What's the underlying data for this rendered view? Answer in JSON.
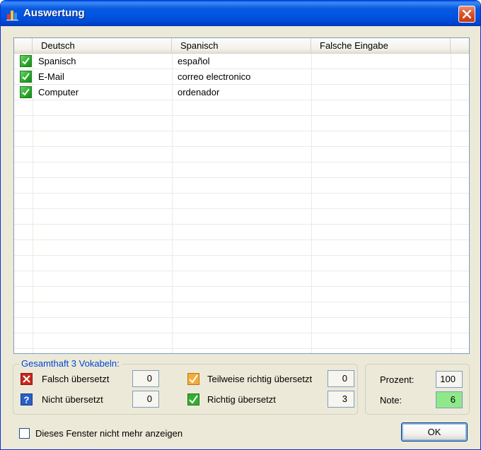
{
  "window": {
    "title": "Auswertung"
  },
  "table": {
    "columns": [
      "Deutsch",
      "Spanisch",
      "Falsche Eingabe"
    ],
    "rows": [
      {
        "status": "check-icon",
        "deutsch": "Spanisch",
        "spanisch": "español",
        "falsch": ""
      },
      {
        "status": "check-icon",
        "deutsch": "E-Mail",
        "spanisch": "correo electronico",
        "falsch": ""
      },
      {
        "status": "check-icon",
        "deutsch": "Computer",
        "spanisch": "ordenador",
        "falsch": ""
      }
    ]
  },
  "summary": {
    "legend": "Gesamthaft 3 Vokabeln:",
    "falsch_label": "Falsch übersetzt",
    "falsch_value": "0",
    "nicht_label": "Nicht übersetzt",
    "nicht_value": "0",
    "teilweise_label": "Teilweise richtig übersetzt",
    "teilweise_value": "0",
    "richtig_label": "Richtig übersetzt",
    "richtig_value": "3"
  },
  "score": {
    "prozent_label": "Prozent:",
    "prozent_value": "100",
    "note_label": "Note:",
    "note_value": "6"
  },
  "footer": {
    "checkbox_label": "Dieses Fenster nicht mehr anzeigen",
    "ok_label": "OK"
  },
  "colors": {
    "title_blue": "#0054e3",
    "legend_blue": "#0046d5",
    "note_green": "#8fe88a",
    "close_red": "#d9542f"
  }
}
